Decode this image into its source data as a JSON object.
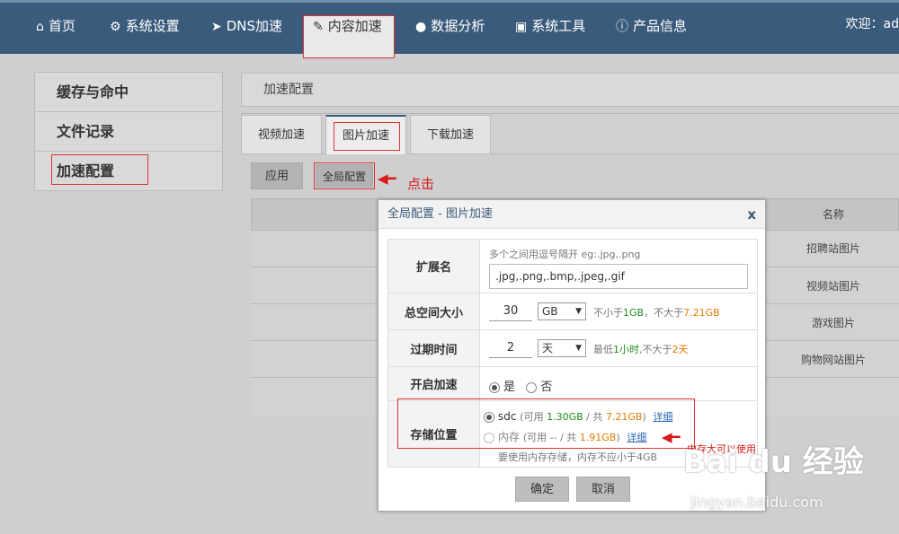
{
  "nav": {
    "items": [
      {
        "label": "首页",
        "icon": "home-icon",
        "glyph": "⌂"
      },
      {
        "label": "系统设置",
        "icon": "gears-icon",
        "glyph": "⚙"
      },
      {
        "label": "DNS加速",
        "icon": "send-icon",
        "glyph": "➤"
      },
      {
        "label": "内容加速",
        "icon": "edit-icon",
        "glyph": "✎"
      },
      {
        "label": "数据分析",
        "icon": "user-icon",
        "glyph": "●"
      },
      {
        "label": "系统工具",
        "icon": "briefcase-icon",
        "glyph": "▣"
      },
      {
        "label": "产品信息",
        "icon": "info-icon",
        "glyph": "ⓘ"
      }
    ],
    "welcome": "欢迎：ad"
  },
  "sidebar": {
    "items": [
      {
        "label": "缓存与命中"
      },
      {
        "label": "文件记录"
      },
      {
        "label": "加速配置"
      }
    ]
  },
  "main": {
    "header": "加速配置",
    "tabs": [
      {
        "label": "视频加速"
      },
      {
        "label": "图片加速"
      },
      {
        "label": "下载加速"
      }
    ],
    "apply_button": "应用",
    "global_button": "全局配置",
    "annotation_click": "点击",
    "table": {
      "col_name": "名称",
      "rows": [
        "招聘站图片",
        "视频站图片",
        "游戏图片",
        "购物网站图片"
      ]
    }
  },
  "modal": {
    "title": "全局配置 - 图片加速",
    "close": "x",
    "ext": {
      "label": "扩展名",
      "hint": "多个之间用逗号隔开 eg:.jpg,.png",
      "value": ".jpg,.png,.bmp,.jpeg,.gif"
    },
    "space": {
      "label": "总空间大小",
      "value": "30",
      "unit": "GB",
      "hint_prefix": "不小于",
      "hint_min": "1GB",
      "hint_mid": "，不大于",
      "hint_max": "7.21GB"
    },
    "expire": {
      "label": "过期时间",
      "value": "2",
      "unit": "天",
      "hint_prefix": "最低",
      "hint_min": "1小时",
      "hint_mid": ",不大于",
      "hint_max": "2天"
    },
    "enable": {
      "label": "开启加速",
      "yes": "是",
      "no": "否"
    },
    "storage": {
      "label": "存储位置",
      "opt1_name": "sdc",
      "opt1_pre": "(可用 ",
      "opt1_avail": "1.30GB",
      "opt1_mid": " / 共 ",
      "opt1_total": "7.21GB",
      "opt1_post": ")",
      "opt2_name": "内存",
      "opt2_pre": "(可用 -- / 共 ",
      "opt2_total": "1.91GB",
      "opt2_post": ")",
      "detail": "详细",
      "note": "要使用内存存储，内存不应小于4GB"
    },
    "confirm": "确定",
    "cancel": "取消"
  },
  "annotation_memory": "内存大可以使用",
  "watermark": "Bai du 经验",
  "watermark_url": "jingyan.baidu.com",
  "colors": {
    "nav_bg": "#3b5b7c",
    "highlight": "#dd3333",
    "green": "#1a8c1a",
    "orange": "#e07b00"
  }
}
